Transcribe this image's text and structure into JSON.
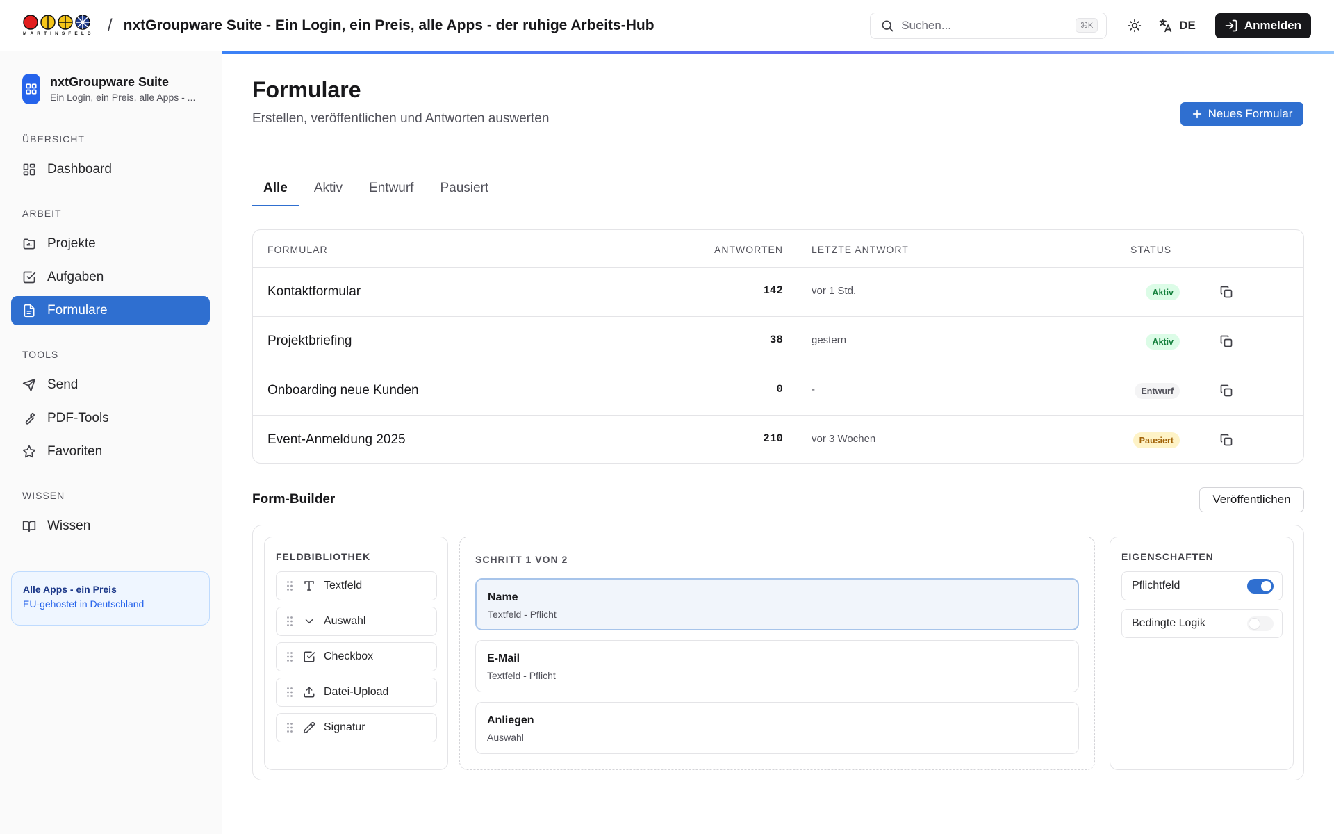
{
  "header": {
    "logo_text": "MARTINSFELD",
    "separator": "/",
    "title": "nxtGroupware Suite - Ein Login, ein Preis, alle Apps - der ruhige Arbeits-Hub",
    "search_placeholder": "Suchen...",
    "search_shortcut": "⌘K",
    "language": "DE",
    "login_label": "Anmelden"
  },
  "sidebar": {
    "brand_name": "nxtGroupware Suite",
    "brand_sub": "Ein Login, ein Preis, alle Apps - ...",
    "sections": {
      "overview": "ÜBERSICHT",
      "work": "ARBEIT",
      "tools": "TOOLS",
      "knowledge": "WISSEN"
    },
    "items": {
      "dashboard": "Dashboard",
      "projects": "Projekte",
      "tasks": "Aufgaben",
      "forms": "Formulare",
      "send": "Send",
      "pdf_tools": "PDF-Tools",
      "favorites": "Favoriten",
      "knowledge": "Wissen"
    },
    "active_item": "forms",
    "promo": {
      "title": "Alle Apps - ein Preis",
      "subtitle": "EU-gehostet in Deutschland"
    }
  },
  "page": {
    "title": "Formulare",
    "subtitle": "Erstellen, veröffentlichen und Antworten auswerten",
    "new_button": "Neues Formular"
  },
  "tabs": [
    "Alle",
    "Aktiv",
    "Entwurf",
    "Pausiert"
  ],
  "active_tab": "Alle",
  "table": {
    "headers": {
      "form": "FORMULAR",
      "responses": "ANTWORTEN",
      "last_response": "LETZTE ANTWORT",
      "status": "STATUS"
    },
    "rows": [
      {
        "name": "Kontaktformular",
        "responses": "142",
        "last": "vor 1 Std.",
        "status": "Aktiv"
      },
      {
        "name": "Projektbriefing",
        "responses": "38",
        "last": "gestern",
        "status": "Aktiv"
      },
      {
        "name": "Onboarding neue Kunden",
        "responses": "0",
        "last": "-",
        "status": "Entwurf"
      },
      {
        "name": "Event-Anmeldung 2025",
        "responses": "210",
        "last": "vor 3 Wochen",
        "status": "Pausiert"
      }
    ]
  },
  "status_colors": {
    "Aktiv": {
      "bg": "#dcfce7",
      "fg": "#15803d"
    },
    "Entwurf": {
      "bg": "#f4f4f5",
      "fg": "#52525b"
    },
    "Pausiert": {
      "bg": "#fef3c7",
      "fg": "#a16207"
    }
  },
  "builder": {
    "title": "Form-Builder",
    "publish_label": "Veröffentlichen",
    "library": {
      "title": "FELDBIBLIOTHEK",
      "items": [
        {
          "label": "Textfeld",
          "icon": "text-icon"
        },
        {
          "label": "Auswahl",
          "icon": "chevron-down-icon"
        },
        {
          "label": "Checkbox",
          "icon": "checkbox-icon"
        },
        {
          "label": "Datei-Upload",
          "icon": "upload-icon"
        },
        {
          "label": "Signatur",
          "icon": "pen-icon"
        }
      ]
    },
    "canvas": {
      "step_label": "SCHRITT 1 VON 2",
      "fields": [
        {
          "name": "Name",
          "meta": "Textfeld - Pflicht",
          "selected": true
        },
        {
          "name": "E-Mail",
          "meta": "Textfeld - Pflicht",
          "selected": false
        },
        {
          "name": "Anliegen",
          "meta": "Auswahl",
          "selected": false
        }
      ]
    },
    "properties": {
      "title": "EIGENSCHAFTEN",
      "items": [
        {
          "label": "Pflichtfeld",
          "on": true
        },
        {
          "label": "Bedingte Logik",
          "on": false
        }
      ]
    }
  },
  "colors": {
    "accent": "#2f6fd0",
    "toggle_on": "#2f6fd0",
    "toggle_off": "#f4f4f5"
  }
}
